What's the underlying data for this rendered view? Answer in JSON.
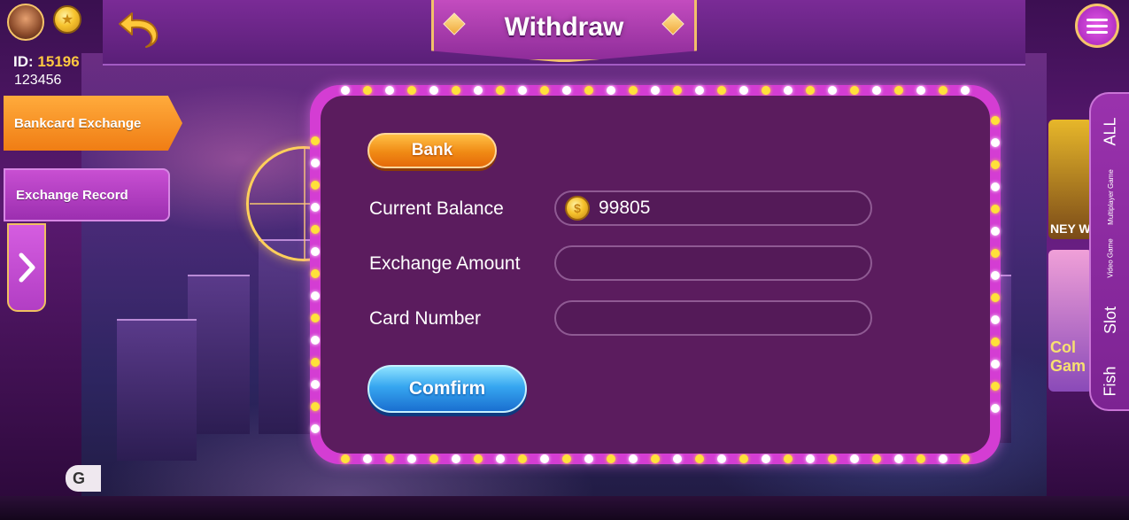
{
  "header": {
    "title": "Withdraw",
    "back_icon": "back-arrow-icon"
  },
  "player": {
    "id_label": "ID:",
    "id_value": "15196",
    "sub_value": "123456"
  },
  "left_tabs": [
    {
      "label": "Bankcard Exchange",
      "active": true
    },
    {
      "label": "Exchange Record",
      "active": false
    }
  ],
  "left_fragment": "G",
  "right_tabs": [
    {
      "label": "ALL"
    },
    {
      "label": "Multiplayer Game"
    },
    {
      "label": "Video Game"
    },
    {
      "label": "Slot"
    },
    {
      "label": "Fish"
    }
  ],
  "right_thumbs": [
    {
      "label": "NEY W"
    },
    {
      "label": "Col Gam"
    }
  ],
  "form": {
    "method_button": "Bank",
    "balance_label": "Current Balance",
    "balance_value": "99805",
    "amount_label": "Exchange Amount",
    "amount_value": "",
    "card_label": "Card Number",
    "card_value": "",
    "confirm_button": "Comfirm"
  },
  "colors": {
    "accent_orange": "#f08a14",
    "accent_blue": "#36a6f0",
    "panel_bg": "#5b1c5e",
    "frame_pink": "#d43dd3",
    "bulb_white": "#ffffff",
    "bulb_yellow": "#ffe13a"
  }
}
